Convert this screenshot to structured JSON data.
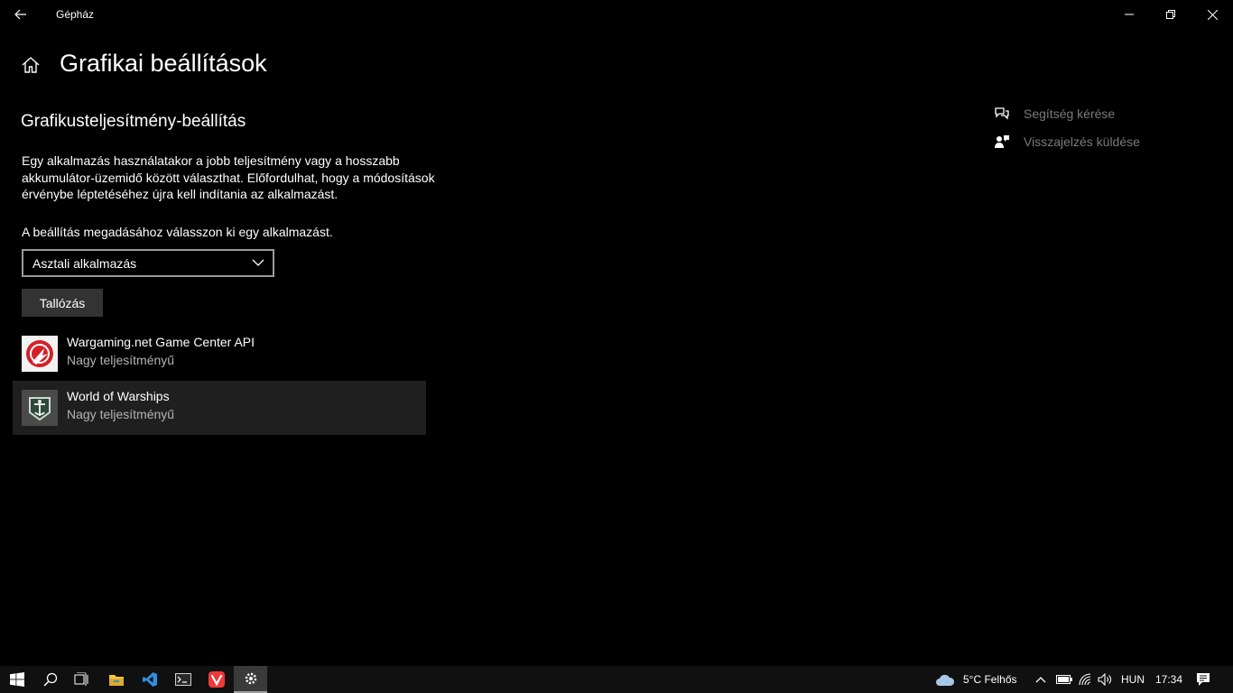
{
  "window": {
    "title": "Gépház",
    "back_icon": "back-arrow-icon",
    "controls": [
      "minimize-icon",
      "restore-icon",
      "close-icon"
    ]
  },
  "page": {
    "title": "Grafikai beállítások",
    "section_title": "Grafikusteljesítmény-beállítás",
    "description": "Egy alkalmazás használatakor a jobb teljesítmény vagy a hosszabb akkumulátor-üzemidő között választhat. Előfordulhat, hogy a módosítások érvénybe léptetéséhez újra kell indítania az alkalmazást.",
    "select_label": "A beállítás megadásához válasszon ki egy alkalmazást.",
    "dropdown_value": "Asztali alkalmazás",
    "browse_label": "Tallózás"
  },
  "apps": [
    {
      "name": "Wargaming.net Game Center API",
      "mode": "Nagy teljesítményű",
      "icon": "wargaming-icon",
      "selected": false
    },
    {
      "name": "World of Warships",
      "mode": "Nagy teljesítményű",
      "icon": "world-of-warships-icon",
      "selected": true
    }
  ],
  "help": {
    "get_help": "Segítség kérése",
    "feedback": "Visszajelzés küldése"
  },
  "taskbar": {
    "weather": "5°C  Felhős",
    "language": "HUN",
    "time": "17:34",
    "apps": [
      "windows-start-icon",
      "search-icon",
      "task-view-icon",
      "file-explorer-icon",
      "vscode-icon",
      "terminal-icon",
      "vivaldi-icon",
      "settings-icon"
    ]
  },
  "colors": {
    "background": "#000000",
    "selected_row": "#1f1f1f",
    "button": "#333333",
    "muted_text": "#7a7a7a",
    "wargaming_red": "#d32027",
    "vivaldi_red": "#ef3939",
    "vscode_blue": "#2d8fe0",
    "folder_yellow": "#f4c542"
  }
}
